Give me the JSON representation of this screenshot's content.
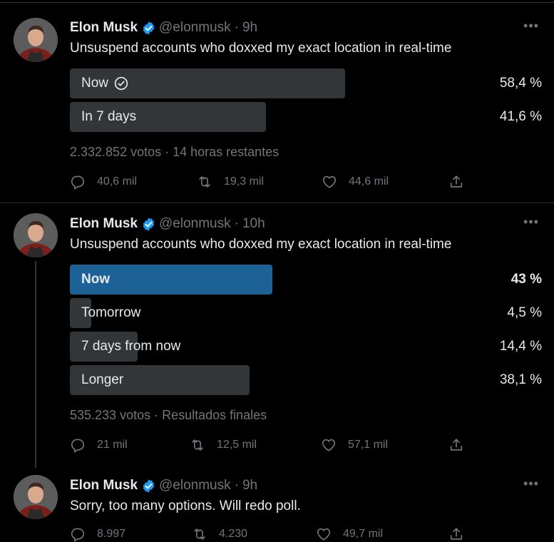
{
  "author": {
    "name": "Elon Musk",
    "handle": "@elonmusk"
  },
  "tweets": [
    {
      "time": "9h",
      "text": "Unsuspend accounts who doxxed my exact location in real-time",
      "poll": {
        "options": [
          {
            "label": "Now",
            "percent_text": "58,4 %",
            "percent": 58.4,
            "selected": true
          },
          {
            "label": "In 7 days",
            "percent_text": "41,6 %",
            "percent": 41.6
          }
        ],
        "summary": "2.332.852 votos · 14 horas restantes"
      },
      "replies": "40,6 mil",
      "retweets": "19,3 mil",
      "likes": "44,6 mil"
    },
    {
      "time": "10h",
      "text": "Unsuspend accounts who doxxed my exact location in real-time",
      "poll": {
        "options": [
          {
            "label": "Now",
            "percent_text": "43 %",
            "percent": 43,
            "winner": true
          },
          {
            "label": "Tomorrow",
            "percent_text": "4,5 %",
            "percent": 4.5
          },
          {
            "label": "7 days from now",
            "percent_text": "14,4 %",
            "percent": 14.4
          },
          {
            "label": "Longer",
            "percent_text": "38,1 %",
            "percent": 38.1
          }
        ],
        "summary": "535.233 votos · Resultados finales"
      },
      "replies": "21 mil",
      "retweets": "12,5 mil",
      "likes": "57,1 mil"
    },
    {
      "time": "9h",
      "text": "Sorry, too many options. Will redo poll.",
      "replies": "8.997",
      "retweets": "4.230",
      "likes": "49,7 mil"
    }
  ],
  "icons": {
    "more": "more-icon",
    "reply": "reply-icon",
    "retweet": "retweet-icon",
    "like": "heart-icon",
    "share": "share-icon",
    "verified": "verified-badge-icon",
    "check": "check-circle-icon"
  },
  "colors": {
    "background": "#000000",
    "text": "#e7e9ea",
    "muted": "#71767b",
    "bar": "#333639",
    "winner_bar": "#1d6296",
    "verified": "#1d9bf0"
  }
}
